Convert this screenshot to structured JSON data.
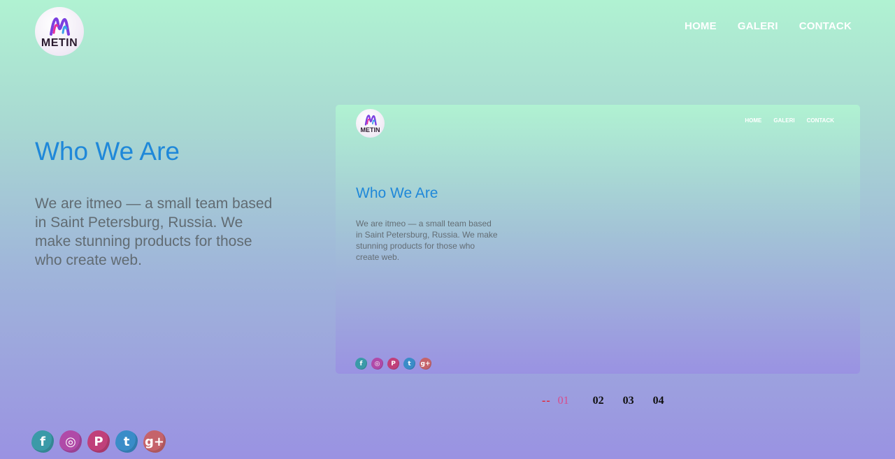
{
  "brand": {
    "logo_text": "METIN"
  },
  "nav": {
    "items": [
      "HOME",
      "GALERI",
      "CONTACK"
    ]
  },
  "hero": {
    "title": "Who We Are",
    "text": "We are itmeo — a small team based in Saint Petersburg, Russia. We make stunning products for those who create web."
  },
  "preview": {
    "logo_text": "METIN",
    "nav": [
      "HOME",
      "GALERI",
      "CONTACK"
    ],
    "title": "Who We Are",
    "text": "We are itmeo — a small team based in Saint Petersburg, Russia. We make stunning products for those who create web."
  },
  "social": {
    "icons": [
      {
        "name": "facebook-icon",
        "glyph": "f",
        "color": "#3b9aa8"
      },
      {
        "name": "instagram-icon",
        "glyph": "◎",
        "color": "#b04aa8"
      },
      {
        "name": "pinterest-icon",
        "glyph": "P",
        "color": "#c0407a"
      },
      {
        "name": "twitter-icon",
        "glyph": "t",
        "color": "#3a8cc8"
      },
      {
        "name": "google-plus-icon",
        "glyph": "g+",
        "color": "#c5636a"
      }
    ]
  },
  "pager": {
    "dash": "--",
    "pages": [
      "01",
      "02",
      "03",
      "04"
    ],
    "active_index": 0
  },
  "colors": {
    "accent": "#1f88d9",
    "active_page": "#d94a8a",
    "dash": "#e8202a"
  }
}
